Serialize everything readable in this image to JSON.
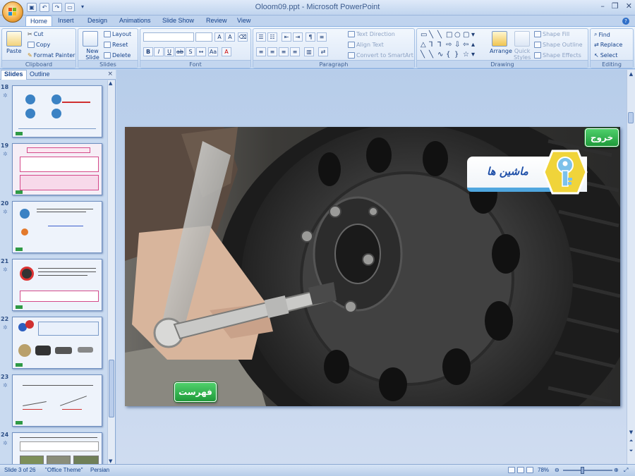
{
  "window": {
    "title": "Oloom09.ppt - Microsoft PowerPoint"
  },
  "tabs": [
    "Home",
    "Insert",
    "Design",
    "Animations",
    "Slide Show",
    "Review",
    "View"
  ],
  "clipboard": {
    "paste": "Paste",
    "cut": "Cut",
    "copy": "Copy",
    "format_painter": "Format Painter",
    "label": "Clipboard"
  },
  "slides_group": {
    "new_slide": "New Slide",
    "layout": "Layout",
    "reset": "Reset",
    "delete": "Delete",
    "label": "Slides"
  },
  "font_group": {
    "label": "Font"
  },
  "paragraph_group": {
    "text_direction": "Text Direction",
    "align_text": "Align Text",
    "convert_smartart": "Convert to SmartArt",
    "label": "Paragraph"
  },
  "drawing_group": {
    "arrange": "Arrange",
    "quick_styles": "Quick Styles",
    "shape_fill": "Shape Fill",
    "shape_outline": "Shape Outline",
    "shape_effects": "Shape Effects",
    "label": "Drawing"
  },
  "editing_group": {
    "find": "Find",
    "replace": "Replace",
    "select": "Select",
    "label": "Editing"
  },
  "pane": {
    "tab_slides": "Slides",
    "tab_outline": "Outline",
    "close": "×"
  },
  "thumbnails": [
    {
      "number": "18"
    },
    {
      "number": "19"
    },
    {
      "number": "20"
    },
    {
      "number": "21"
    },
    {
      "number": "22"
    },
    {
      "number": "23"
    },
    {
      "number": "24"
    }
  ],
  "slide": {
    "exit_button": "خروج",
    "contents_button": "فهرست",
    "logo_text": "ماشین ها"
  },
  "status": {
    "slide_info": "Slide 3 of 26",
    "theme": "\"Office Theme\"",
    "language": "Persian",
    "zoom": "78%"
  },
  "colors": {
    "ribbon_accent": "#15428b",
    "green_button": "#2fae4a",
    "logo_yellow": "#f0d43a",
    "logo_blue": "#4fa6de"
  }
}
